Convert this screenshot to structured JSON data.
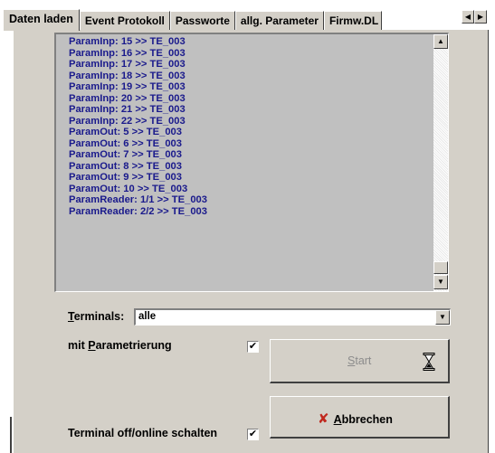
{
  "tabs": [
    {
      "label": "Daten laden",
      "active": true
    },
    {
      "label": "Event Protokoll",
      "active": false
    },
    {
      "label": "Passworte",
      "active": false
    },
    {
      "label": "allg. Parameter",
      "active": false
    },
    {
      "label": "Firmw.DL",
      "active": false
    }
  ],
  "tab_scroll": {
    "left_icon": "arrow-left-icon",
    "right_icon": "arrow-right-icon"
  },
  "log": {
    "lines": [
      "ParamInp: 15 >> TE_003",
      "ParamInp: 16 >> TE_003",
      "ParamInp: 17 >> TE_003",
      "ParamInp: 18 >> TE_003",
      "ParamInp: 19 >> TE_003",
      "ParamInp: 20 >> TE_003",
      "ParamInp: 21 >> TE_003",
      "ParamInp: 22 >> TE_003",
      "ParamOut: 5 >> TE_003",
      "ParamOut: 6 >> TE_003",
      "ParamOut: 7 >> TE_003",
      "ParamOut: 8 >> TE_003",
      "ParamOut: 9 >> TE_003",
      "ParamOut: 10 >> TE_003",
      "ParamReader: 1/1 >> TE_003",
      "ParamReader: 2/2 >> TE_003"
    ],
    "text_color": "#1a1a8c"
  },
  "terminals": {
    "label_mnemonic": "T",
    "label_rest": "erminals:",
    "value": "alle"
  },
  "parametrierung": {
    "label_prefix": "mit ",
    "label_mnemonic": "P",
    "label_rest": "arametrierung",
    "checked_mark": "✔"
  },
  "online": {
    "label": "Terminal off/online schalten",
    "checked_mark": "✔"
  },
  "start_button": {
    "label_mnemonic": "S",
    "label_rest": "tart",
    "enabled": false,
    "icon": "hourglass-icon"
  },
  "abort_button": {
    "icon_glyph": "✘",
    "label_mnemonic": "A",
    "label_rest": "bbrechen",
    "icon_color": "#c0281e"
  }
}
